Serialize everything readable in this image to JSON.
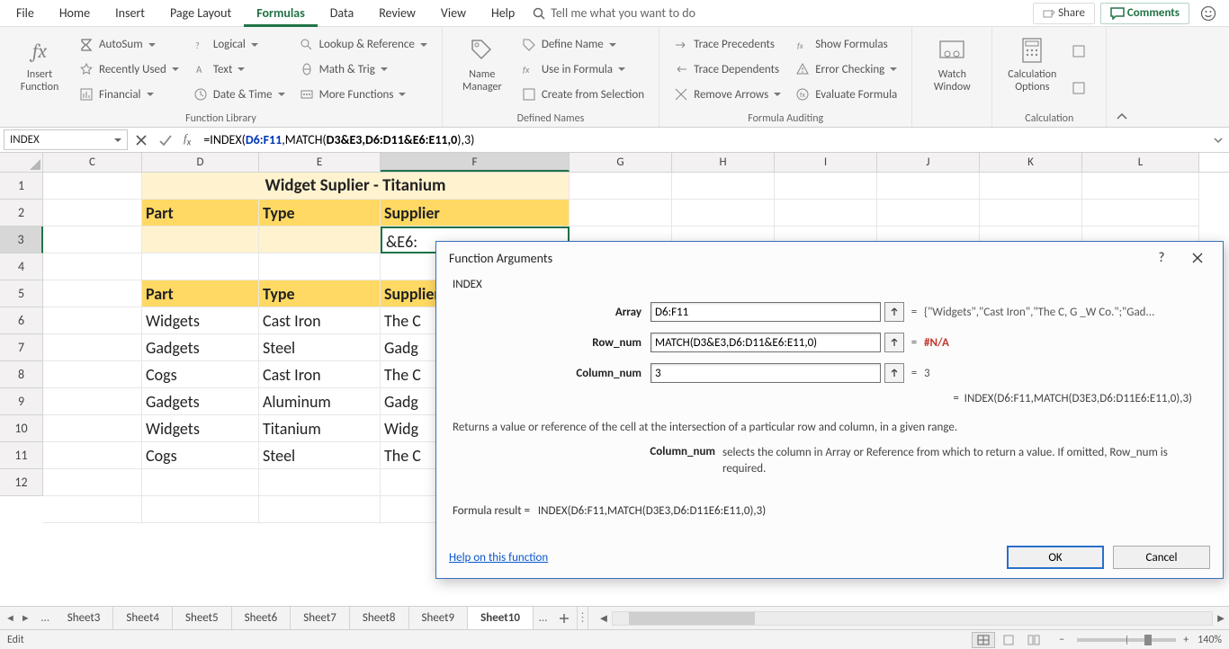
{
  "tabs": {
    "file": "File",
    "home": "Home",
    "insert": "Insert",
    "pageLayout": "Page Layout",
    "formulas": "Formulas",
    "data": "Data",
    "review": "Review",
    "view": "View",
    "help": "Help",
    "tellMe": "Tell me what you want to do",
    "share": "Share",
    "comments": "Comments"
  },
  "ribbon": {
    "insertFunction": "Insert\nFunction",
    "autosum": "AutoSum",
    "recent": "Recently Used",
    "financial": "Financial",
    "logical": "Logical",
    "text": "Text",
    "datetime": "Date & Time",
    "lookup": "Lookup & Reference",
    "math": "Math & Trig",
    "more": "More Functions",
    "nameManager": "Name\nManager",
    "defineName": "Define Name",
    "useInFormula": "Use in Formula",
    "createFromSel": "Create from Selection",
    "tracePrec": "Trace Precedents",
    "traceDep": "Trace Dependents",
    "removeArrows": "Remove Arrows",
    "showFormulas": "Show Formulas",
    "errorCheck": "Error Checking",
    "evalFormula": "Evaluate Formula",
    "watch": "Watch\nWindow",
    "calcOptions": "Calculation\nOptions",
    "grpLib": "Function Library",
    "grpNames": "Defined Names",
    "grpAudit": "Formula Auditing",
    "grpCalc": "Calculation"
  },
  "nameBox": "INDEX",
  "formula": {
    "p1": "=INDEX(",
    "arr": "D6:F11",
    "p2": ",MATCH(",
    "m1": "D3",
    "amp1": "&",
    "m2": "E3",
    "c1": ",",
    "m3": "D6:D11",
    "amp2": "&",
    "m4": "E6:E11",
    "c2": ",",
    "zero": "0",
    "p3": ")",
    ",": ",",
    "col": "3",
    "end": ")"
  },
  "columns": [
    "C",
    "D",
    "E",
    "F",
    "G",
    "H",
    "I",
    "J",
    "K",
    "L"
  ],
  "rows": [
    "1",
    "2",
    "3",
    "4",
    "5",
    "6",
    "7",
    "8",
    "9",
    "10",
    "11",
    "12"
  ],
  "sheet": {
    "title": "Widget Suplier - Titanium",
    "hdrPart": "Part",
    "hdrType": "Type",
    "hdrSupplier": "Supplier",
    "f3": "&E6:",
    "d6": "Widgets",
    "e6": "Cast Iron",
    "f6": "The C",
    "d7": "Gadgets",
    "e7": "Steel",
    "f7": "Gadg",
    "d8": "Cogs",
    "e8": "Cast Iron",
    "f8": "The C",
    "d9": "Gadgets",
    "e9": "Aluminum",
    "f9": "Gadg",
    "d10": "Widgets",
    "e10": "Titanium",
    "f10": "Widg",
    "d11": "Cogs",
    "e11": "Steel",
    "f11": "The C"
  },
  "dialog": {
    "title": "Function Arguments",
    "fn": "INDEX",
    "lblArray": "Array",
    "lblRow": "Row_num",
    "lblCol": "Column_num",
    "valArray": "D6:F11",
    "valRow": "MATCH(D3&E3,D6:D11&E6:E11,0)",
    "valCol": "3",
    "resArray": "{\"Widgets\",\"Cast Iron\",\"The C, G _W Co.\";\"Gad...",
    "resRow": "#N/A",
    "resCol": "3",
    "bigResult": "INDEX(D6:F11,MATCH(D3E3,D6:D11E6:E11,0),3)",
    "desc": "Returns a value or reference of the cell at the intersection of a particular row and column, in a given range.",
    "argName": "Column_num",
    "argDesc": "selects the column in Array or Reference from which to return a value. If omitted, Row_num is required.",
    "formulaResultLabel": "Formula result =",
    "formulaResult": "INDEX(D6:F11,MATCH(D3E3,D6:D11E6:E11,0),3)",
    "help": "Help on this function",
    "ok": "OK",
    "cancel": "Cancel"
  },
  "sheets": [
    "Sheet3",
    "Sheet4",
    "Sheet5",
    "Sheet6",
    "Sheet7",
    "Sheet8",
    "Sheet9",
    "Sheet10"
  ],
  "status": {
    "mode": "Edit",
    "zoom": "140%"
  }
}
